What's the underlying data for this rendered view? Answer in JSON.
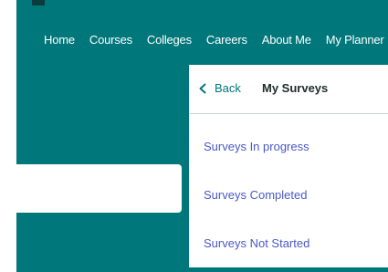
{
  "nav": {
    "items": [
      "Home",
      "Courses",
      "Colleges",
      "Careers",
      "About Me",
      "My Planner"
    ]
  },
  "panel": {
    "back_label": "Back",
    "title": "My Surveys",
    "menu_items": [
      "Surveys In progress",
      "Surveys Completed",
      "Surveys Not Started"
    ]
  },
  "colors": {
    "brand_teal": "#00777a",
    "link_blue": "#4b58c8",
    "white": "#ffffff"
  },
  "icons": {
    "back": "chevron-left-icon"
  }
}
